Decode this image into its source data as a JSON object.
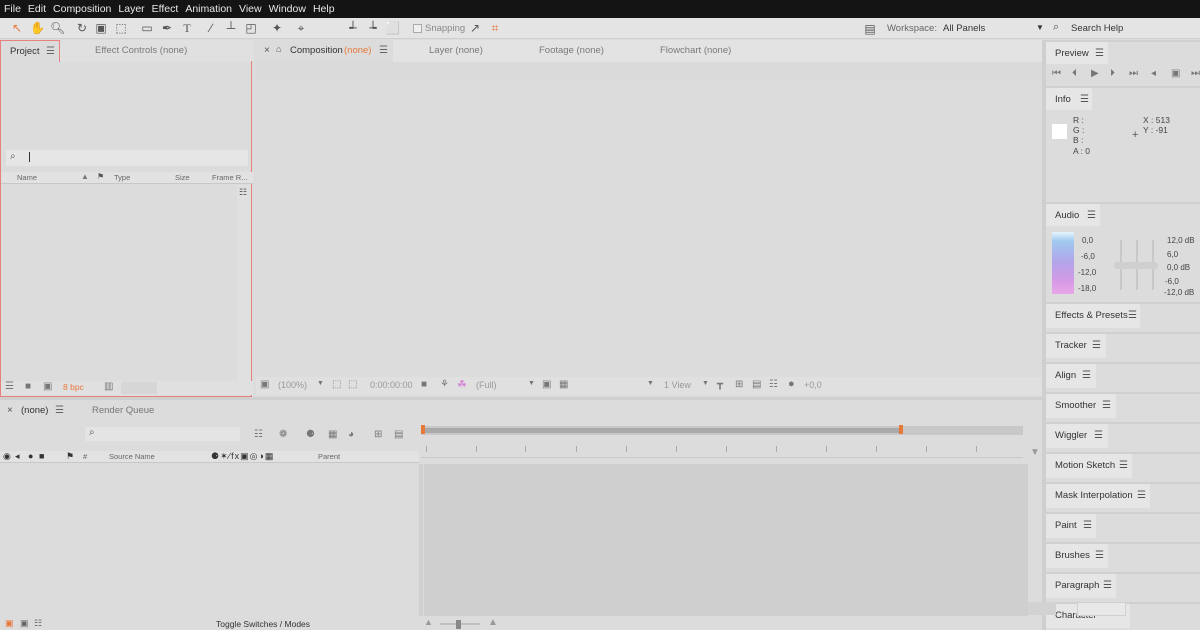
{
  "menu": [
    "File",
    "Edit",
    "Composition",
    "Layer",
    "Effect",
    "Animation",
    "View",
    "Window",
    "Help"
  ],
  "toolbar": {
    "snapping_label": "Snapping",
    "workspace_label": "Workspace:",
    "workspace_value": "All Panels",
    "search_label": "Search Help"
  },
  "project_panel": {
    "tab_project": "Project",
    "tab_effect_controls": "Effect Controls",
    "effect_controls_target": "(none)",
    "columns": [
      "Name",
      "Type",
      "Size",
      "Frame R..."
    ],
    "bpc": "8 bpc"
  },
  "viewer": {
    "tab_composition": "Composition",
    "composition_target": "(none)",
    "tab_layer": "Layer (none)",
    "tab_footage": "Footage (none)",
    "tab_flowchart": "Flowchart (none)",
    "zoom": "(100%)",
    "timecode": "0:00:00:00",
    "resolution": "(Full)",
    "view_count": "1 View",
    "exposure": "+0,0"
  },
  "timeline": {
    "comp_tab": "(none)",
    "render_queue_tab": "Render Queue",
    "col_source": "Source Name",
    "col_parent": "Parent",
    "col_hash": "#",
    "toggle_label": "Toggle Switches / Modes"
  },
  "right_panels": {
    "preview": "Preview",
    "info": "Info",
    "info_r": "R :",
    "info_g": "G :",
    "info_b": "B :",
    "info_a": "A : 0",
    "info_x": "X : 513",
    "info_y": "Y : -91",
    "audio": "Audio",
    "audio_left_scale": [
      "0,0",
      "-6,0",
      "-12,0",
      "-18,0"
    ],
    "audio_right_scale": [
      "12,0 dB",
      "6,0",
      "0,0 dB",
      "-6,0",
      "-12,0 dB"
    ],
    "effects_presets": "Effects & Presets",
    "tracker": "Tracker",
    "align": "Align",
    "smoother": "Smoother",
    "wiggler": "Wiggler",
    "motion_sketch": "Motion Sketch",
    "mask_interpolation": "Mask Interpolation",
    "paint": "Paint",
    "brushes": "Brushes",
    "paragraph": "Paragraph",
    "character": "Character"
  },
  "colors": {
    "menubar_bg": "#141414",
    "accent_orange": "#e8773a",
    "active_panel_border": "#e88080"
  }
}
